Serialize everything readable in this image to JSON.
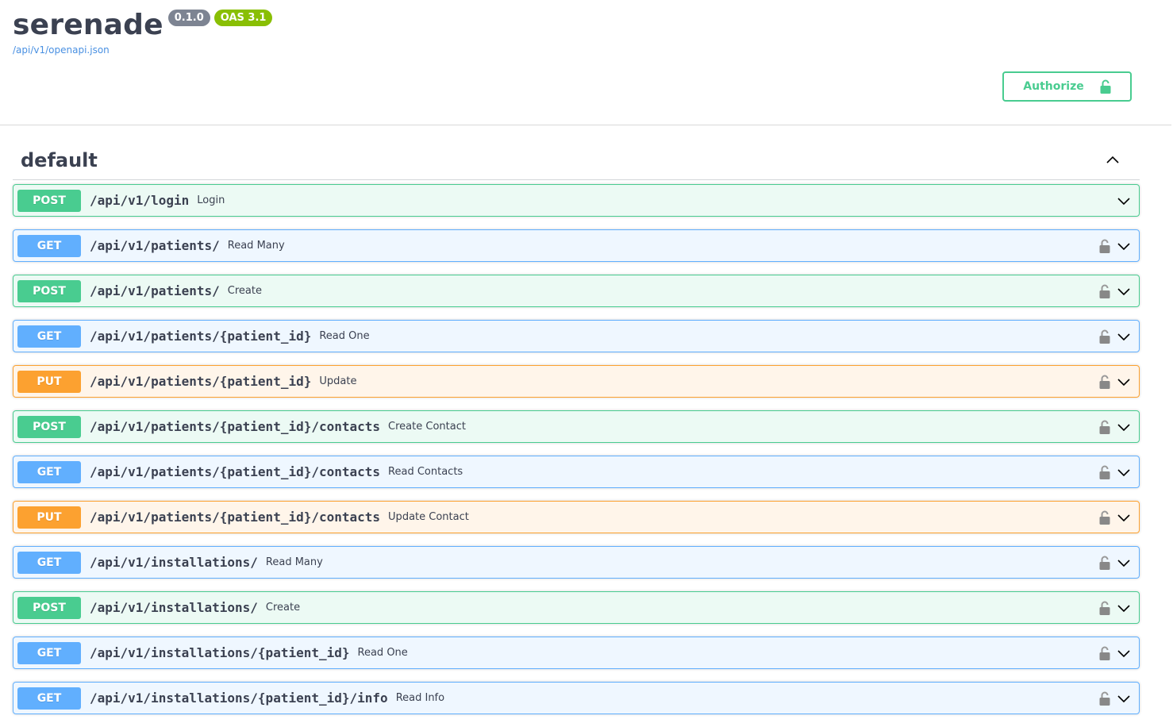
{
  "info": {
    "title": "serenade",
    "version": "0.1.0",
    "oas": "OAS 3.1",
    "spec_url": "/api/v1/openapi.json"
  },
  "authorize": {
    "label": "Authorize",
    "icon": "unlocked-lock-icon"
  },
  "tag": {
    "name": "default",
    "collapse_icon": "chevron-up-icon"
  },
  "colors": {
    "post": "#49cc90",
    "get": "#61affe",
    "put": "#fca130"
  },
  "operations": [
    {
      "method": "POST",
      "path": "/api/v1/login",
      "summary": "Login",
      "locked": false
    },
    {
      "method": "GET",
      "path": "/api/v1/patients/",
      "summary": "Read Many",
      "locked": true
    },
    {
      "method": "POST",
      "path": "/api/v1/patients/",
      "summary": "Create",
      "locked": true
    },
    {
      "method": "GET",
      "path": "/api/v1/patients/{patient_id}",
      "summary": "Read One",
      "locked": true
    },
    {
      "method": "PUT",
      "path": "/api/v1/patients/{patient_id}",
      "summary": "Update",
      "locked": true
    },
    {
      "method": "POST",
      "path": "/api/v1/patients/{patient_id}/contacts",
      "summary": "Create Contact",
      "locked": true
    },
    {
      "method": "GET",
      "path": "/api/v1/patients/{patient_id}/contacts",
      "summary": "Read Contacts",
      "locked": true
    },
    {
      "method": "PUT",
      "path": "/api/v1/patients/{patient_id}/contacts",
      "summary": "Update Contact",
      "locked": true
    },
    {
      "method": "GET",
      "path": "/api/v1/installations/",
      "summary": "Read Many",
      "locked": true
    },
    {
      "method": "POST",
      "path": "/api/v1/installations/",
      "summary": "Create",
      "locked": true
    },
    {
      "method": "GET",
      "path": "/api/v1/installations/{patient_id}",
      "summary": "Read One",
      "locked": true
    },
    {
      "method": "GET",
      "path": "/api/v1/installations/{patient_id}/info",
      "summary": "Read Info",
      "locked": true
    }
  ]
}
